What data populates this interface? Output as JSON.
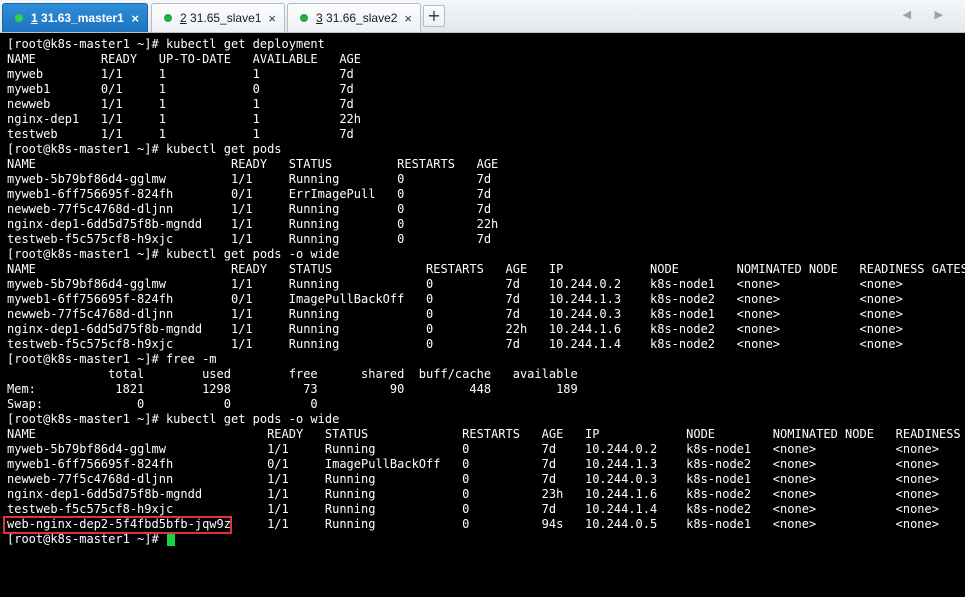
{
  "tabs": [
    {
      "index": "1",
      "label": " 31.63_master1",
      "active": true
    },
    {
      "index": "2",
      "label": " 31.65_slave1",
      "active": false
    },
    {
      "index": "3",
      "label": " 31.66_slave2",
      "active": false
    }
  ],
  "tab_close_glyph": "×",
  "add_tab_glyph": "+",
  "nav_arrows": "◀ ▶",
  "terminal": {
    "lines": [
      "[root@k8s-master1 ~]# kubectl get deployment",
      "NAME         READY   UP-TO-DATE   AVAILABLE   AGE",
      "myweb        1/1     1            1           7d",
      "myweb1       0/1     1            0           7d",
      "newweb       1/1     1            1           7d",
      "nginx-dep1   1/1     1            1           22h",
      "testweb      1/1     1            1           7d",
      "[root@k8s-master1 ~]# kubectl get pods",
      "NAME                           READY   STATUS         RESTARTS   AGE",
      "myweb-5b79bf86d4-gglmw         1/1     Running        0          7d",
      "myweb1-6ff756695f-824fh        0/1     ErrImagePull   0          7d",
      "newweb-77f5c4768d-dljnn        1/1     Running        0          7d",
      "nginx-dep1-6dd5d75f8b-mgndd    1/1     Running        0          22h",
      "testweb-f5c575cf8-h9xjc        1/1     Running        0          7d",
      "[root@k8s-master1 ~]# kubectl get pods -o wide",
      "NAME                           READY   STATUS             RESTARTS   AGE   IP            NODE        NOMINATED NODE   READINESS GATES",
      "myweb-5b79bf86d4-gglmw         1/1     Running            0          7d    10.244.0.2    k8s-node1   <none>           <none>",
      "myweb1-6ff756695f-824fh        0/1     ImagePullBackOff   0          7d    10.244.1.3    k8s-node2   <none>           <none>",
      "newweb-77f5c4768d-dljnn        1/1     Running            0          7d    10.244.0.3    k8s-node1   <none>           <none>",
      "nginx-dep1-6dd5d75f8b-mgndd    1/1     Running            0          22h   10.244.1.6    k8s-node2   <none>           <none>",
      "testweb-f5c575cf8-h9xjc        1/1     Running            0          7d    10.244.1.4    k8s-node2   <none>           <none>",
      "[root@k8s-master1 ~]# free -m",
      "              total        used        free      shared  buff/cache   available",
      "Mem:           1821        1298          73          90         448         189",
      "Swap:             0           0           0",
      "[root@k8s-master1 ~]# kubectl get pods -o wide",
      "NAME                                READY   STATUS             RESTARTS   AGE   IP            NODE        NOMINATED NODE   READINESS GATES",
      "myweb-5b79bf86d4-gglmw              1/1     Running            0          7d    10.244.0.2    k8s-node1   <none>           <none>",
      "myweb1-6ff756695f-824fh             0/1     ImagePullBackOff   0          7d    10.244.1.3    k8s-node2   <none>           <none>",
      "newweb-77f5c4768d-dljnn             1/1     Running            0          7d    10.244.0.3    k8s-node1   <none>           <none>",
      "nginx-dep1-6dd5d75f8b-mgndd         1/1     Running            0          23h   10.244.1.6    k8s-node2   <none>           <none>",
      "testweb-f5c575cf8-h9xjc             1/1     Running            0          7d    10.244.1.4    k8s-node2   <none>           <none>",
      "web-nginx-dep2-5f4fbd5bfb-jqw9z     1/1     Running            0          94s   10.244.0.5    k8s-node1   <none>           <none>"
    ],
    "prompt": "[root@k8s-master1 ~]# ",
    "highlighted_pod": "web-nginx-dep2-5f4fbd5bfb-jqw9z"
  },
  "colors": {
    "background": "#000000",
    "foreground": "#ffffff",
    "cursor": "#16d34a",
    "active_tab": "#1e73be",
    "status_dot": "#1fae3a",
    "highlight_border": "#e0323a"
  }
}
